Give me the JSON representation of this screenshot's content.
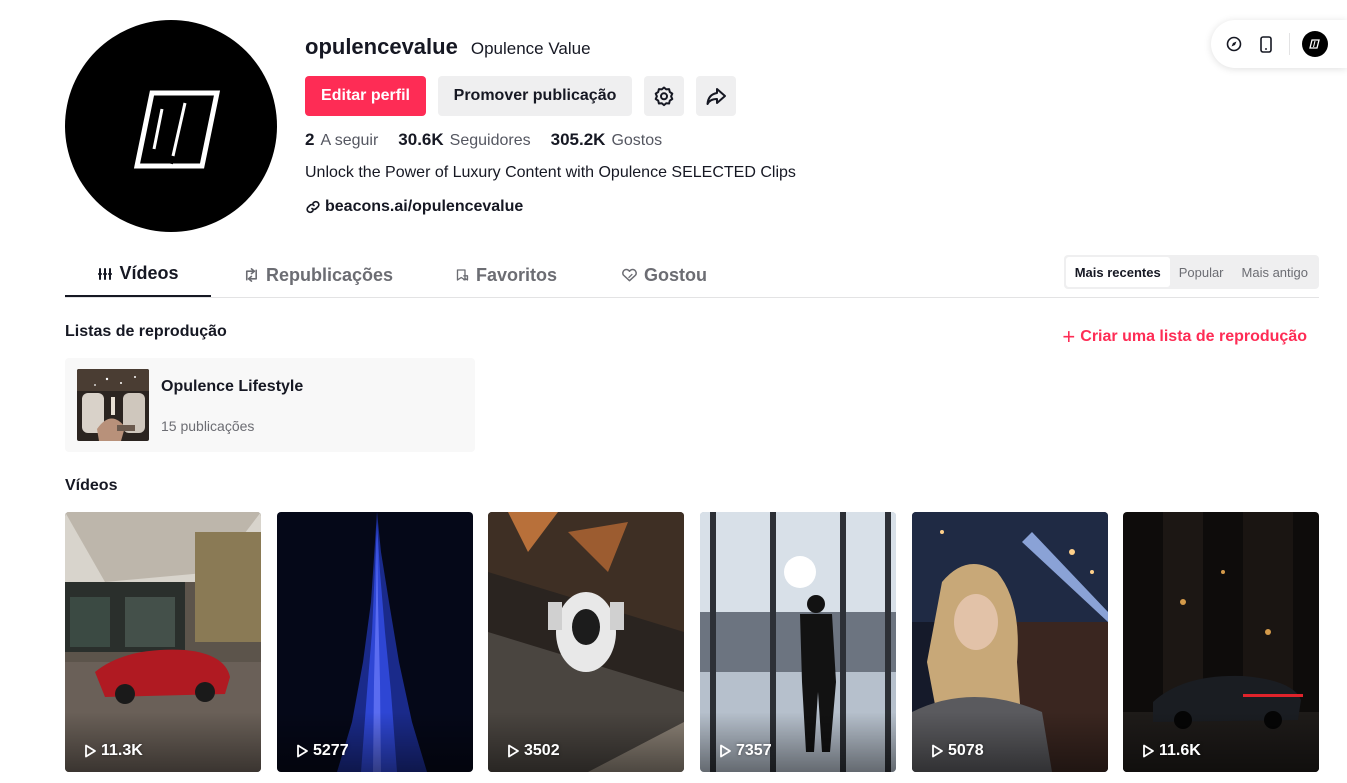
{
  "profile": {
    "username": "opulencevalue",
    "nickname": "Opulence Value",
    "edit_label": "Editar perfil",
    "promote_label": "Promover publicação",
    "following_count": "2",
    "following_label": "A seguir",
    "followers_count": "30.6K",
    "followers_label": "Seguidores",
    "likes_count": "305.2K",
    "likes_label": "Gostos",
    "bio": "Unlock the Power of Luxury Content with Opulence SELECTED Clips",
    "link": "beacons.ai/opulencevalue"
  },
  "tabs": [
    {
      "label": "Vídeos",
      "icon": "grid-icon"
    },
    {
      "label": "Republicações",
      "icon": "repost-icon"
    },
    {
      "label": "Favoritos",
      "icon": "bookmark-icon"
    },
    {
      "label": "Gostou",
      "icon": "liked-heart-icon"
    }
  ],
  "sort": {
    "options": [
      "Mais recentes",
      "Popular",
      "Mais antigo"
    ],
    "selected": "Mais recentes"
  },
  "playlists": {
    "title": "Listas de reprodução",
    "create_label": "Criar uma lista de reprodução",
    "items": [
      {
        "name": "Opulence Lifestyle",
        "count": "15 publicações"
      }
    ]
  },
  "videos": {
    "title": "Vídeos",
    "items": [
      {
        "views": "11.3K"
      },
      {
        "views": "5277"
      },
      {
        "views": "3502"
      },
      {
        "views": "7357"
      },
      {
        "views": "5078"
      },
      {
        "views": "11.6K"
      }
    ]
  },
  "colors": {
    "accent": "#fe2c55",
    "text": "#161823",
    "muted": "#6c6d73",
    "button_bg": "#efeff0"
  }
}
